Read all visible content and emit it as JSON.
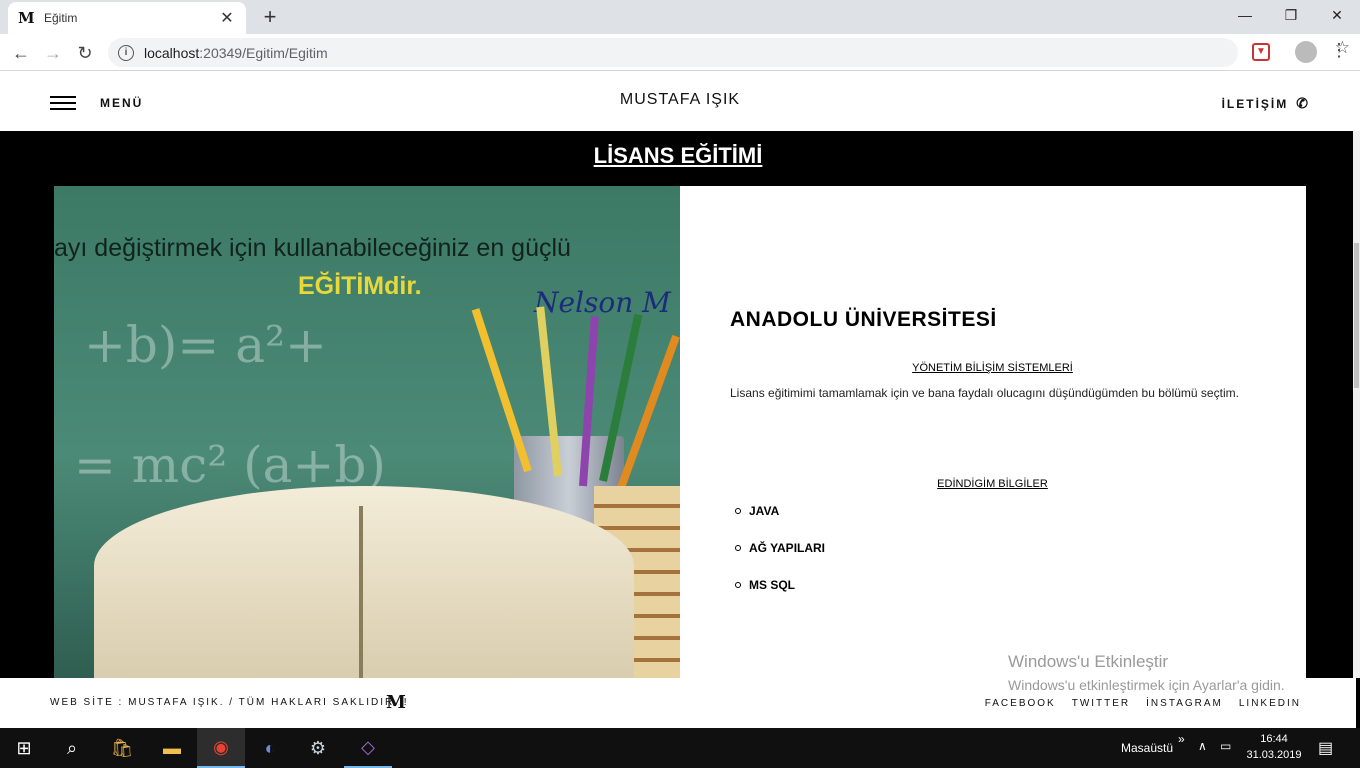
{
  "browser": {
    "tab_title": "Eğitim",
    "tab_favicon": "M",
    "url_host": "localhost",
    "url_rest": ":20349/Egitim/Egitim",
    "icons": [
      "back-icon",
      "forward-icon",
      "reload-icon",
      "info-icon",
      "star-icon",
      "extension-icon",
      "profile-icon",
      "menu-kebab-icon",
      "minimize-icon",
      "restore-icon",
      "close-icon",
      "new-tab-icon"
    ]
  },
  "header": {
    "menu_label": "MENÜ",
    "brand": "MUSTAFA IŞIK",
    "contact_label": "İLETİŞİM"
  },
  "section": {
    "title": "LİSANS EĞİTİMİ"
  },
  "hero": {
    "quote_line1": "ayı değiştirmek için kullanabileceğiniz en güçlü",
    "quote_highlight": "EĞİTİM",
    "quote_suffix": "dir.",
    "signature": "Nelson M"
  },
  "info": {
    "university": "ANADOLU ÜNİVERSİTESİ",
    "department": "YÖNETİM BİLİŞİM SİSTEMLERİ",
    "description": "Lisans eğitimimi tamamlamak için ve bana faydalı olucagını düşündügümden bu bölümü seçtim.",
    "learned_heading": "EDİNDİGİM BİLGİLER",
    "skills": [
      "JAVA",
      "AĞ YAPILARI",
      "MS SQL"
    ]
  },
  "footer": {
    "copyright": "WEB SİTE : MUSTAFA IŞIK. / TÜM HAKLARI SAKLIDIR..!",
    "logo": "M",
    "social": [
      "FACEBOOK",
      "TWITTER",
      "İNSTAGRAM",
      "LINKEDIN"
    ]
  },
  "watermark": {
    "line1": "Windows'u Etkinleştir",
    "line2": "Windows'u etkinleştirmek için Ayarlar'a gidin."
  },
  "taskbar": {
    "desktop_label": "Masaüstü",
    "time": "16:44",
    "date": "31.03.2019"
  }
}
